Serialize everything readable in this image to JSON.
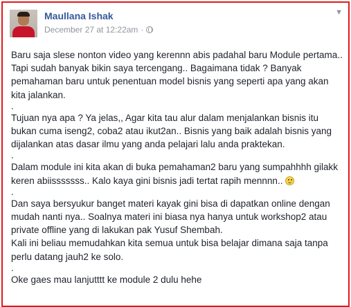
{
  "post": {
    "author": "Maullana Ishak",
    "timestamp": "December 27 at 12:22am",
    "separator": "·",
    "privacy_icon": "globe-icon",
    "menu_icon": "chevron-down-icon",
    "paragraphs": [
      "Baru saja slese nonton video yang kerennn abis padahal baru Module pertama.. Tapi sudah banyak bikin saya tercengang.. Bagaimana tidak ? Banyak pemahaman baru untuk penentuan model bisnis yang seperti apa yang akan kita jalankan.",
      ".",
      "Tujuan nya apa ? Ya jelas,, Agar kita tau alur dalam menjalankan bisnis itu bukan cuma iseng2, coba2 atau ikut2an.. Bisnis yang baik adalah bisnis yang dijalankan atas dasar ilmu yang anda pelajari lalu anda praktekan.",
      ".",
      "Dalam module ini kita akan di buka pemahaman2 baru yang sumpahhhh gilakk keren abiisssssss.. Kalo kaya gini bisnis jadi tertat rapih mennnn..",
      ".",
      "Dan saya bersyukur banget materi kayak gini bisa di dapatkan online dengan mudah nanti nya.. Soalnya materi ini biasa nya hanya untuk workshop2 atau private offline yang di lakukan pak Yusuf Shembah.",
      "Kali ini beliau memudahkan kita semua untuk bisa belajar dimana saja tanpa perlu datang jauh2 ke solo.",
      ".",
      "Oke gaes mau lanjutttt ke module 2 dulu hehe"
    ],
    "emoji": "smiley-icon",
    "frame_color": "#e0191c",
    "link_color": "#365899"
  }
}
